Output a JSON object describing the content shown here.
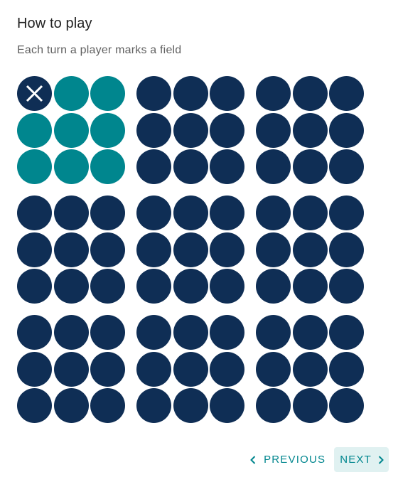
{
  "dialog": {
    "title": "How to play",
    "subtitle": "Each turn a player marks a field"
  },
  "board": {
    "colors": {
      "empty": "#0f2e55",
      "highlighted": "#00868e",
      "mark": "#ffffff"
    },
    "subboards": [
      {
        "cells": [
          "X",
          "H",
          "H",
          "H",
          "H",
          "H",
          "H",
          "H",
          "H"
        ]
      },
      {
        "cells": [
          "",
          "",
          "",
          "",
          "",
          "",
          "",
          "",
          ""
        ]
      },
      {
        "cells": [
          "",
          "",
          "",
          "",
          "",
          "",
          "",
          "",
          ""
        ]
      },
      {
        "cells": [
          "",
          "",
          "",
          "",
          "",
          "",
          "",
          "",
          ""
        ]
      },
      {
        "cells": [
          "",
          "",
          "",
          "",
          "",
          "",
          "",
          "",
          ""
        ]
      },
      {
        "cells": [
          "",
          "",
          "",
          "",
          "",
          "",
          "",
          "",
          ""
        ]
      },
      {
        "cells": [
          "",
          "",
          "",
          "",
          "",
          "",
          "",
          "",
          ""
        ]
      },
      {
        "cells": [
          "",
          "",
          "",
          "",
          "",
          "",
          "",
          "",
          ""
        ]
      },
      {
        "cells": [
          "",
          "",
          "",
          "",
          "",
          "",
          "",
          "",
          ""
        ]
      }
    ]
  },
  "footer": {
    "previous_label": "PREVIOUS",
    "next_label": "NEXT",
    "previous_icon": "chevron-left-icon",
    "next_icon": "chevron-right-icon"
  }
}
